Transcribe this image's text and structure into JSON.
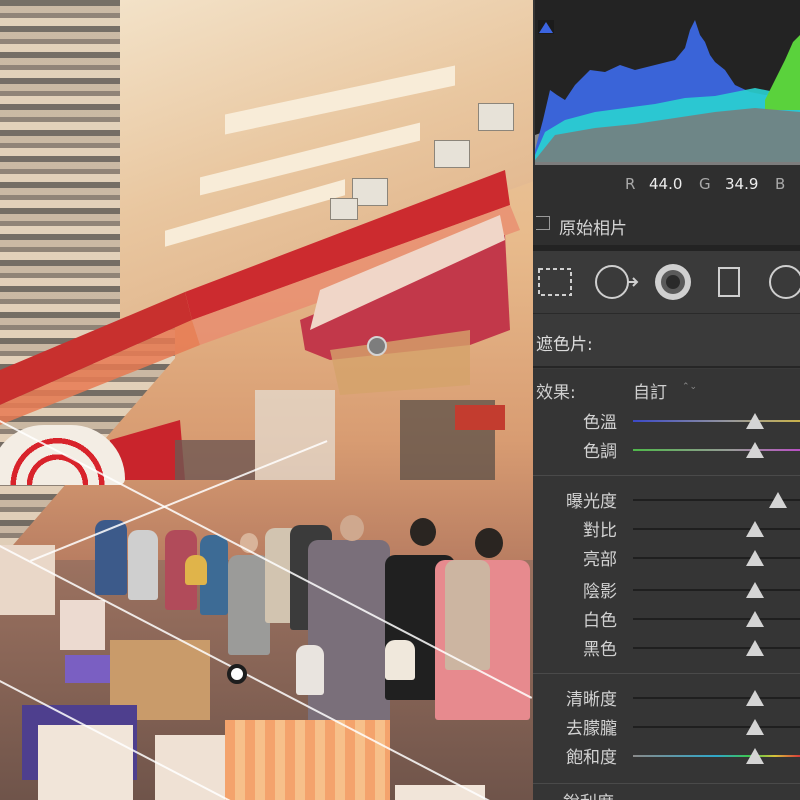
{
  "photo": {
    "description_icon": "photo-canvas",
    "gradient_pins": [
      "mask-pin-top",
      "mask-pin-center"
    ]
  },
  "histogram": {
    "clip_icon": "shadow-clipping-triangle-icon",
    "colors": {
      "blue": "#3a64d8",
      "cyan": "#2ad2d2",
      "green": "#5ad23c",
      "gray": "#8a8a8a"
    }
  },
  "readout": {
    "r_label": "R",
    "r_value": "44.0",
    "g_label": "G",
    "g_value": "34.9",
    "b_label": "B"
  },
  "original": {
    "label": "原始相片"
  },
  "tools": [
    "marquee-icon",
    "circle-arrow-icon",
    "radial-mask-icon",
    "rectangle-icon",
    "circle-icon"
  ],
  "mask": {
    "label": "遮色片:"
  },
  "effect": {
    "label": "效果:",
    "value": "自訂",
    "arrow": "⌃⌄"
  },
  "sliders": {
    "temp": {
      "label": "色溫",
      "value": 0.73
    },
    "tint": {
      "label": "色調",
      "value": 0.73
    },
    "exposure": {
      "label": "曝光度",
      "value": 0.87
    },
    "contrast": {
      "label": "對比",
      "value": 0.73
    },
    "highlights": {
      "label": "亮部",
      "value": 0.73
    },
    "shadows": {
      "label": "陰影",
      "value": 0.73
    },
    "whites": {
      "label": "白色",
      "value": 0.73
    },
    "blacks": {
      "label": "黑色",
      "value": 0.73
    },
    "clarity": {
      "label": "清晰度",
      "value": 0.73
    },
    "dehaze": {
      "label": "去朦朧",
      "value": 0.73
    },
    "saturation": {
      "label": "飽和度",
      "value": 0.73
    }
  },
  "bottom": {
    "label": "銳利度"
  }
}
